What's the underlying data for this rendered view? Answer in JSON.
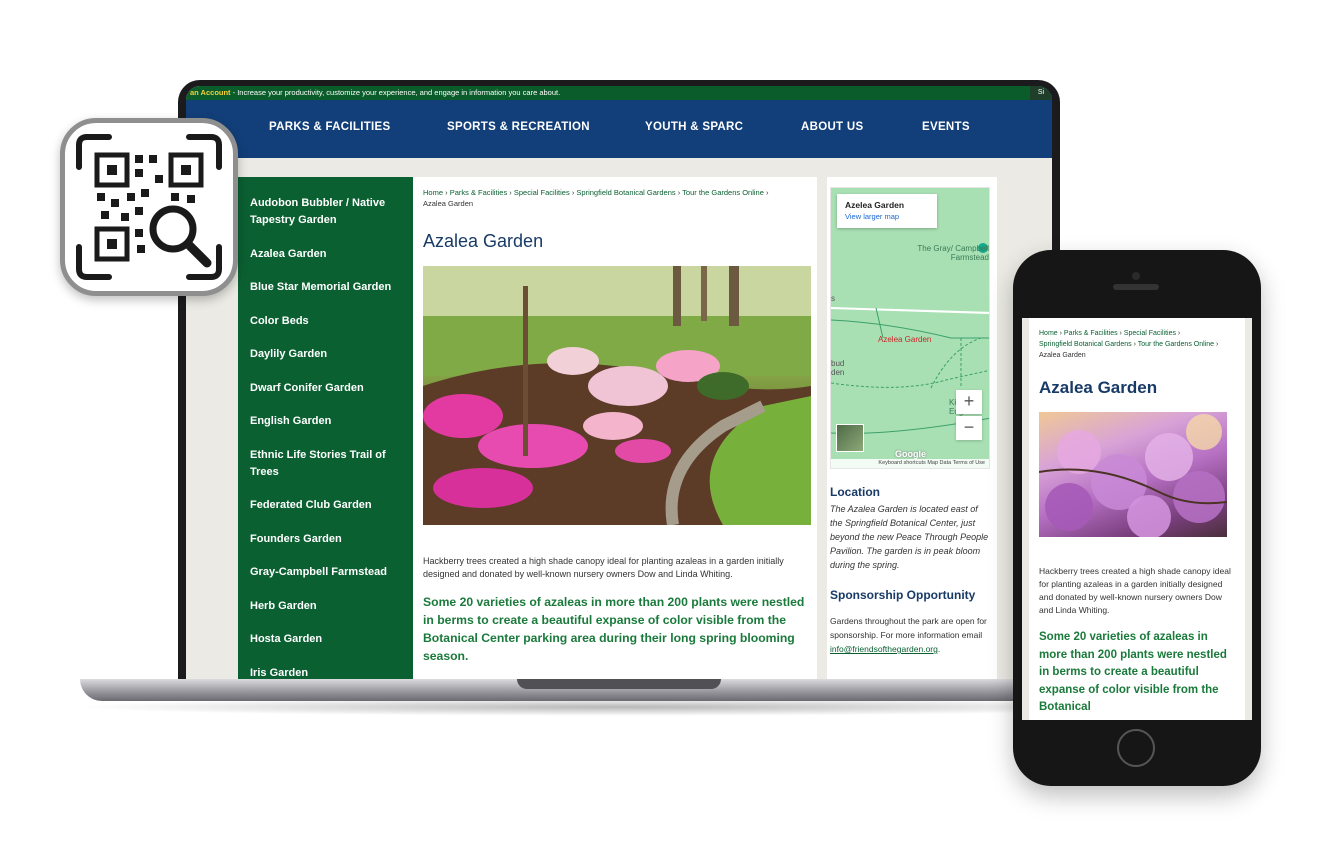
{
  "topbar": {
    "account_label": "an Account",
    "message": " - Increase your productivity, customize your experience, and engage in information you care about.",
    "signin": "Si"
  },
  "nav": {
    "items": [
      "PARKS & FACILITIES",
      "SPORTS & RECREATION",
      "YOUTH & SPARC",
      "ABOUT US",
      "EVENTS"
    ]
  },
  "sidebar": {
    "items": [
      "Audobon Bubbler / Native Tapestry Garden",
      "Azalea Garden",
      "Blue Star Memorial Garden",
      "Color Beds",
      "Daylily Garden",
      "Dwarf Conifer Garden",
      "English Garden",
      "Ethnic Life Stories Trail of Trees",
      "Federated Club Garden",
      "Founders Garden",
      "Gray-Campbell Farmstead",
      "Herb Garden",
      "Hosta Garden",
      "Iris Garden"
    ]
  },
  "breadcrumb": {
    "links": [
      "Home",
      "Parks & Facilities",
      "Special Facilities",
      "Springfield Botanical Gardens",
      "Tour the Gardens Online"
    ],
    "current": "Azalea Garden",
    "separator": " › "
  },
  "main": {
    "title": "Azalea Garden",
    "body": "Hackberry trees created a high shade canopy ideal for planting azaleas in a garden initially designed and donated by well-known nursery owners Dow and Linda Whiting.",
    "lead": "Some 20 varieties of azaleas in more than 200 plants were nestled in berms to create a beautiful expanse of color visible from the Botanical Center parking area during their long spring blooming season."
  },
  "map": {
    "card_title": "Azelea Garden",
    "card_link": "View larger map",
    "label_farmstead": "The Gray/ Campbell Farmstead",
    "label_pin": "Azelea Garden",
    "label_left1": "s",
    "label_left2": "bud den",
    "label_kickapoo": "Kickapoo Edg",
    "zoom_in": "+",
    "zoom_out": "−",
    "google": "Google",
    "footer": "Keyboard shortcuts   Map Data   Terms of Use"
  },
  "aside": {
    "location_heading": "Location",
    "location_text": "The Azalea Garden is located east of the Springfield Botanical Center, just beyond the new Peace Through People Pavilion. The garden is in peak bloom during the spring.",
    "sponsor_heading": "Sponsorship Opportunity",
    "sponsor_text": "Gardens throughout the park are open for sponsorship. For more information email ",
    "sponsor_email": "info@friendsofthegarden.org",
    "sponsor_end": "."
  },
  "phone": {
    "breadcrumb_links": [
      "Home",
      "Parks & Facilities",
      "Special Facilities",
      "Springfield Botanical Gardens",
      "Tour the Gardens Online"
    ],
    "breadcrumb_current": "Azalea Garden",
    "title": "Azalea Garden",
    "body": "Hackberry trees created a high shade canopy ideal for planting azaleas in a garden initially designed and donated by well-known nursery owners Dow and Linda Whiting.",
    "lead": "Some 20 varieties of azaleas in more than 200 plants were nestled in berms to create a beautiful expanse of color visible from the Botanical"
  },
  "colors": {
    "nav_blue": "#123f79",
    "sidebar_green": "#0b6032",
    "lead_green": "#1a7a3b",
    "title_blue": "#183a66"
  },
  "icons": {
    "qr_badge": "qr-code-search-icon",
    "map_pin": "map-pin-icon"
  }
}
